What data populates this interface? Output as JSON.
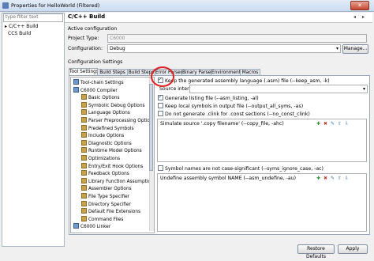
{
  "window": {
    "title": "Properties for HelloWorld (Filtered)",
    "close": "✕"
  },
  "left": {
    "filter_placeholder": "type filter text",
    "tree": [
      "C/C++ Build",
      "CCS Build"
    ]
  },
  "header": {
    "title": "C/C++ Build"
  },
  "active_config": {
    "section_label": "Active configuration",
    "project_type_label": "Project Type:",
    "project_type_value": "C6000",
    "configuration_label": "Configuration:",
    "configuration_value": "Debug",
    "manage_button": "Manage..."
  },
  "config_settings": {
    "section_label": "Configuration Settings",
    "tabs": [
      "Tool Settings",
      "Build Steps",
      "Build Steps",
      "Error Parsers",
      "Binary Parser",
      "Environment",
      "Macros"
    ]
  },
  "option_tree": [
    {
      "label": "Tool-chain Settings",
      "kind": "gear",
      "level": 0
    },
    {
      "label": "C6000 Compiler",
      "kind": "gear",
      "level": 0
    },
    {
      "label": "Basic Options",
      "kind": "opt",
      "level": 1
    },
    {
      "label": "Symbolic Debug Options",
      "kind": "opt",
      "level": 1
    },
    {
      "label": "Language Options",
      "kind": "opt",
      "level": 1
    },
    {
      "label": "Parser Preprocessing Option",
      "kind": "opt",
      "level": 1
    },
    {
      "label": "Predefined Symbols",
      "kind": "opt",
      "level": 1
    },
    {
      "label": "Include Options",
      "kind": "opt",
      "level": 1
    },
    {
      "label": "Diagnostic Options",
      "kind": "opt",
      "level": 1
    },
    {
      "label": "Runtime Model Options",
      "kind": "opt",
      "level": 1
    },
    {
      "label": "Optimizations",
      "kind": "opt",
      "level": 1
    },
    {
      "label": "Entry/Exit Hook Options",
      "kind": "opt",
      "level": 1
    },
    {
      "label": "Feedback Options",
      "kind": "opt",
      "level": 1
    },
    {
      "label": "Library Function Assumptio",
      "kind": "opt",
      "level": 1
    },
    {
      "label": "Assembler Options",
      "kind": "opt",
      "level": 1
    },
    {
      "label": "File Type Specifier",
      "kind": "opt",
      "level": 1
    },
    {
      "label": "Directory Specifier",
      "kind": "opt",
      "level": 1
    },
    {
      "label": "Default File Extensions",
      "kind": "opt",
      "level": 1
    },
    {
      "label": "Command Files",
      "kind": "opt",
      "level": 1
    },
    {
      "label": "C6000 Linker",
      "kind": "gear",
      "level": 0
    }
  ],
  "options": {
    "keep_asm": "Keep the generated assembly language (.asm) file (--keep_asm, -k)",
    "source_interlist": "Source interlist",
    "gen_listing": "Generate listing file (--asm_listing, -al)",
    "output_all_syms": "Keep local symbols in output file (--output_all_syms, -as)",
    "no_const_clink": "Do not generate .clink for .const sections (--no_const_clink)",
    "simulate_source": "Simulate source '.copy filename' (--copy_file, -ahc)",
    "syms_ignore_case": "Symbol names are not case-significant (--syms_ignore_case, -ac)",
    "undefine": "Undefine assembly symbol NAME (--asm_undefine, -au)"
  },
  "footer": {
    "restore_defaults": "Restore Defaults",
    "apply": "Apply"
  }
}
